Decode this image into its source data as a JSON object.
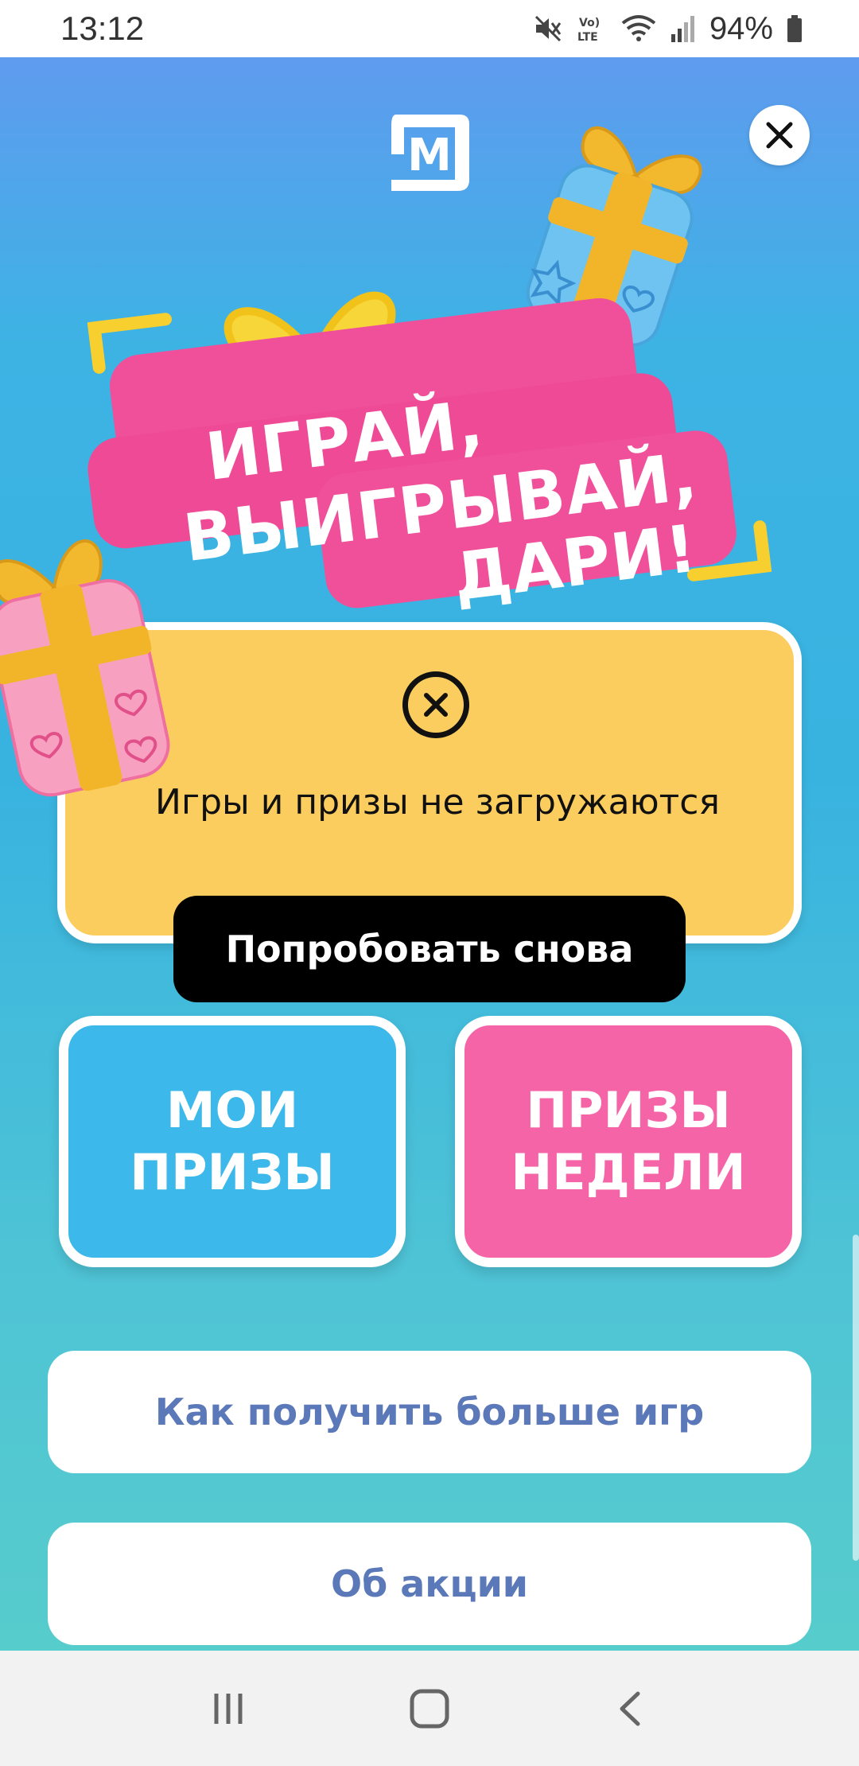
{
  "status_bar": {
    "time": "13:12",
    "battery_percent": "94%",
    "icons": [
      "mute-icon",
      "volte-icon",
      "wifi-icon",
      "signal-icon",
      "battery-icon"
    ]
  },
  "app": {
    "logo_icon": "magnit-logo-icon",
    "close_icon": "close-icon",
    "headline": {
      "line1": "ИГРАЙ,",
      "line2": "ВЫИГРЫВАЙ,",
      "line3": "ДАРИ!"
    },
    "error": {
      "icon": "error-x-icon",
      "message": "Игры и призы не загружаются",
      "retry_label": "Попробовать снова"
    },
    "tiles": {
      "my_prizes": "МОИ ПРИЗЫ",
      "weekly_prizes": "ПРИЗЫ НЕДЕЛИ"
    },
    "buttons": {
      "more_games": "Как получить больше игр",
      "about": "Об акции"
    }
  },
  "nav_bar": {
    "recent_icon": "recent-apps-icon",
    "home_icon": "home-icon",
    "back_icon": "back-icon"
  },
  "colors": {
    "background_top": "#5f9bef",
    "background_bottom": "#57cccc",
    "banner_pink": "#f0509a",
    "card_yellow": "#fbcd5e",
    "tile_blue": "#3cb8ea",
    "tile_pink": "#f564a6",
    "link_text": "#5b79b9"
  }
}
